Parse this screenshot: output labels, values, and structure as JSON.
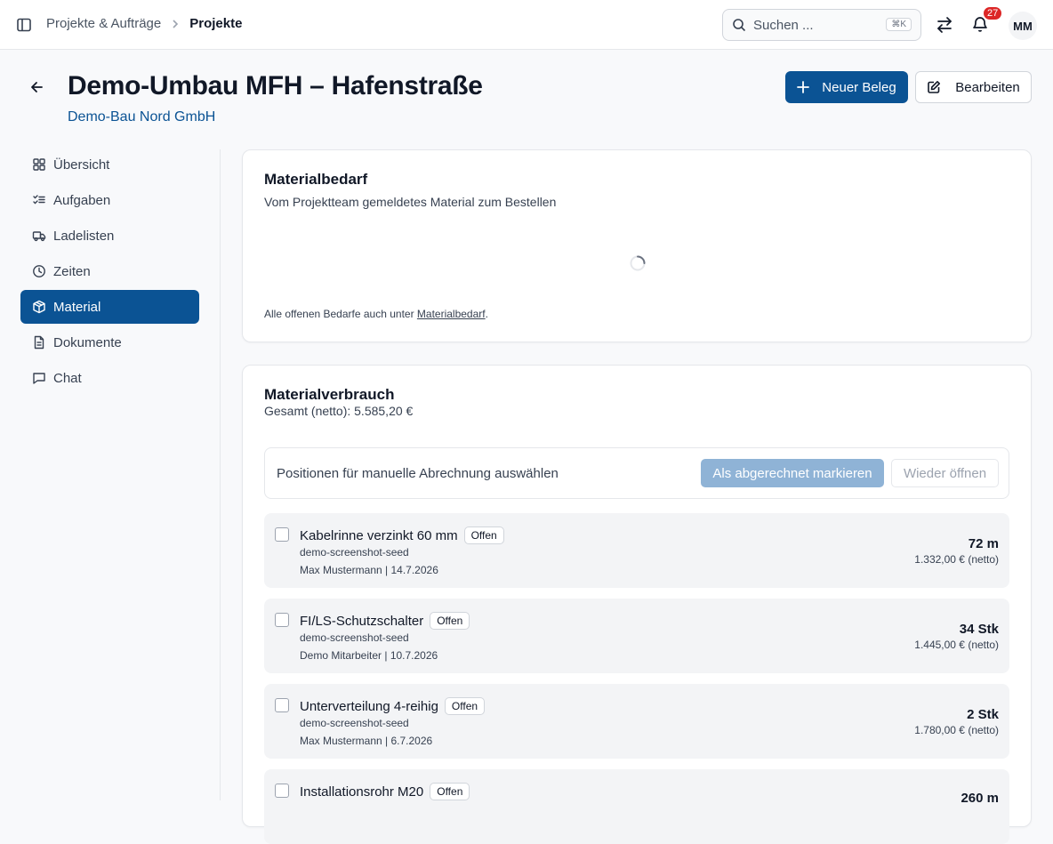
{
  "topbar": {
    "breadcrumb": {
      "parent": "Projekte & Aufträge",
      "current": "Projekte"
    },
    "search": {
      "placeholder": "Suchen ...",
      "shortcut": "⌘K"
    },
    "notifications_count": "27",
    "avatar_initials": "MM"
  },
  "header": {
    "title": "Demo-Umbau MFH – Hafenstraße",
    "subtitle": "Demo-Bau Nord GmbH",
    "new_doc_label": "Neuer Beleg",
    "edit_label": "Bearbeiten"
  },
  "nav": {
    "items": [
      {
        "label": "Übersicht",
        "icon": "dashboard-icon"
      },
      {
        "label": "Aufgaben",
        "icon": "list-check-icon"
      },
      {
        "label": "Ladelisten",
        "icon": "truck-icon"
      },
      {
        "label": "Zeiten",
        "icon": "clock-icon"
      },
      {
        "label": "Material",
        "icon": "package-icon"
      },
      {
        "label": "Dokumente",
        "icon": "document-icon"
      },
      {
        "label": "Chat",
        "icon": "chat-icon"
      }
    ],
    "active": "Material"
  },
  "material_demand": {
    "title": "Materialbedarf",
    "subtitle": "Vom Projektteam gemeldetes Material zum Bestellen",
    "footnote_prefix": "Alle offenen Bedarfe auch unter ",
    "footnote_link": "Materialbedarf",
    "footnote_suffix": "."
  },
  "material_usage": {
    "title": "Materialverbrauch",
    "total": "Gesamt (netto): 5.585,20 €",
    "selection_label": "Positionen für manuelle Abrechnung auswählen",
    "mark_billed_label": "Als abgerechnet markieren",
    "reopen_label": "Wieder öffnen",
    "items": [
      {
        "name": "Kabelrinne verzinkt 60 mm",
        "status": "Offen",
        "source": "demo-screenshot-seed",
        "meta": "Max Mustermann | 14.7.2026",
        "qty": "72 m",
        "price": "1.332,00 € (netto)"
      },
      {
        "name": "FI/LS-Schutzschalter",
        "status": "Offen",
        "source": "demo-screenshot-seed",
        "meta": "Demo Mitarbeiter | 10.7.2026",
        "qty": "34 Stk",
        "price": "1.445,00 € (netto)"
      },
      {
        "name": "Unterverteilung 4-reihig",
        "status": "Offen",
        "source": "demo-screenshot-seed",
        "meta": "Max Mustermann | 6.7.2026",
        "qty": "2 Stk",
        "price": "1.780,00 € (netto)"
      },
      {
        "name": "Installationsrohr M20",
        "status": "Offen",
        "source": "",
        "meta": "",
        "qty": "260 m",
        "price": ""
      }
    ]
  },
  "colors": {
    "primary": "#0b5394",
    "badge": "#dc2626",
    "disabled_primary": "#8fb3d6"
  }
}
